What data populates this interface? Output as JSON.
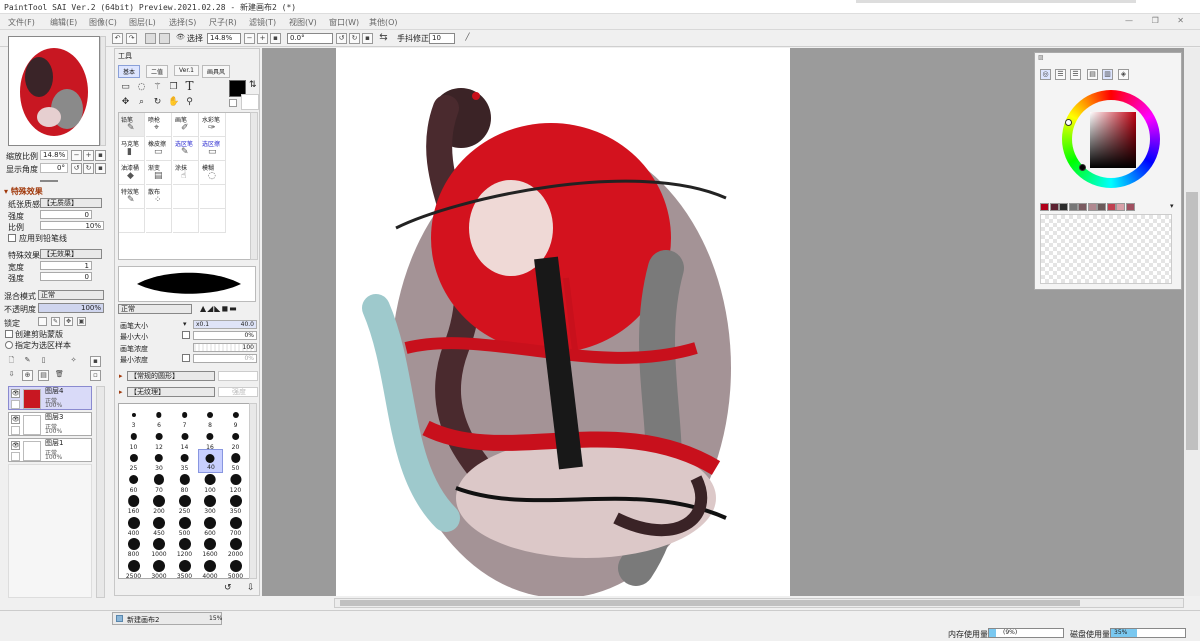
{
  "title": "PaintTool SAI Ver.2 (64bit) Preview.2021.02.28 - 新建画布2 (*)",
  "menu": [
    "文件(F)",
    "编辑(E)",
    "图像(C)",
    "图层(L)",
    "选择(S)",
    "尺子(R)",
    "滤镜(T)",
    "视图(V)",
    "窗口(W)",
    "其他(O)"
  ],
  "window_buttons": "— ❐ ✕",
  "toolbar": {
    "zoom": "14.8%",
    "select_label": "选择",
    "rotation": "0.0°",
    "stabilizer_label": "手抖修正",
    "stabilizer_value": "10"
  },
  "navigator": {
    "zoom_label": "缩放比例",
    "zoom_value": "14.8%",
    "angle_label": "显示角度",
    "angle_value": "0°"
  },
  "effects": {
    "header": "特殊效果",
    "paper_label": "纸张质感",
    "paper_value": "【无质感】",
    "strength_label": "强度",
    "strength_value": "0",
    "scale_label": "比例",
    "scale_value": "10%",
    "apply_pen": "应用到铅笔线",
    "effect_label": "特殊效果",
    "effect_value": "【无效果】",
    "width_label": "宽度",
    "width_value": "1",
    "strength2_label": "强度",
    "strength2_value": "0"
  },
  "layer_props": {
    "blend_label": "混合模式",
    "blend_value": "正常",
    "opacity_label": "不透明度",
    "opacity_value": "100%",
    "lock_label": "锁定",
    "clip_label": "创建剪贴蒙版",
    "sel_source_label": "指定为选区样本"
  },
  "layers": [
    {
      "name": "图层4",
      "mode": "正常",
      "opacity": "100%",
      "selected": true
    },
    {
      "name": "图层3",
      "mode": "正常",
      "opacity": "100%",
      "selected": false
    },
    {
      "name": "图层1",
      "mode": "正常",
      "opacity": "100%",
      "selected": false
    }
  ],
  "toolpanel": {
    "title": "工具",
    "tabs": [
      "基本",
      "二值",
      "Ver.1",
      "画具风"
    ],
    "brushes": [
      {
        "name": "铅笔",
        "glyph": "✎"
      },
      {
        "name": "喷枪",
        "glyph": "⌖"
      },
      {
        "name": "画笔",
        "glyph": "✐"
      },
      {
        "name": "水彩笔",
        "glyph": "✑"
      },
      {
        "name": "马克笔",
        "glyph": "▮"
      },
      {
        "name": "橡皮擦",
        "glyph": "▭"
      },
      {
        "name": "选区笔",
        "glyph": "✎"
      },
      {
        "name": "选区擦",
        "glyph": "▭"
      },
      {
        "name": "油漆桶",
        "glyph": "◆"
      },
      {
        "name": "渐变",
        "glyph": "▤"
      },
      {
        "name": "涂抹",
        "glyph": "☝"
      },
      {
        "name": "模糊",
        "glyph": "◌"
      },
      {
        "name": "特效笔",
        "glyph": "✎"
      },
      {
        "name": "散布",
        "glyph": "⁘"
      }
    ],
    "blend": "正常",
    "max_size_label": "画笔大小",
    "max_size_mult": "x0.1",
    "max_size_value": "40.0",
    "min_size_label": "最小大小",
    "min_size_value": "0%",
    "density_label": "画笔浓度",
    "density_value": "100",
    "min_density_label": "最小浓度",
    "min_density_value": "0%",
    "shape": "【常规的圆形】",
    "texture": "【无纹理】",
    "texture_strength": "强度"
  },
  "sizes": [
    "3",
    "6",
    "7",
    "8",
    "9",
    "10",
    "12",
    "14",
    "16",
    "20",
    "25",
    "30",
    "35",
    "40",
    "50",
    "60",
    "70",
    "80",
    "100",
    "120",
    "160",
    "200",
    "250",
    "300",
    "350",
    "400",
    "450",
    "500",
    "600",
    "700",
    "800",
    "1000",
    "1200",
    "1600",
    "2000",
    "2500",
    "3000",
    "3500",
    "4000",
    "5000"
  ],
  "selected_size": "40",
  "swatches": [
    "#b0001a",
    "#5b2030",
    "#2b2b2b",
    "#777777",
    "#7a5a60",
    "#b08890",
    "#6c5a5a",
    "#c04050",
    "#d8a0a8",
    "#a05060"
  ],
  "status": {
    "doc_tab": "新建画布2",
    "doc_zoom": "15%",
    "mem_label": "内存使用量",
    "mem_value": "(9%)",
    "mem_pct": 9,
    "disk_label": "磁盘使用量",
    "disk_value": "35%",
    "disk_pct": 35
  }
}
